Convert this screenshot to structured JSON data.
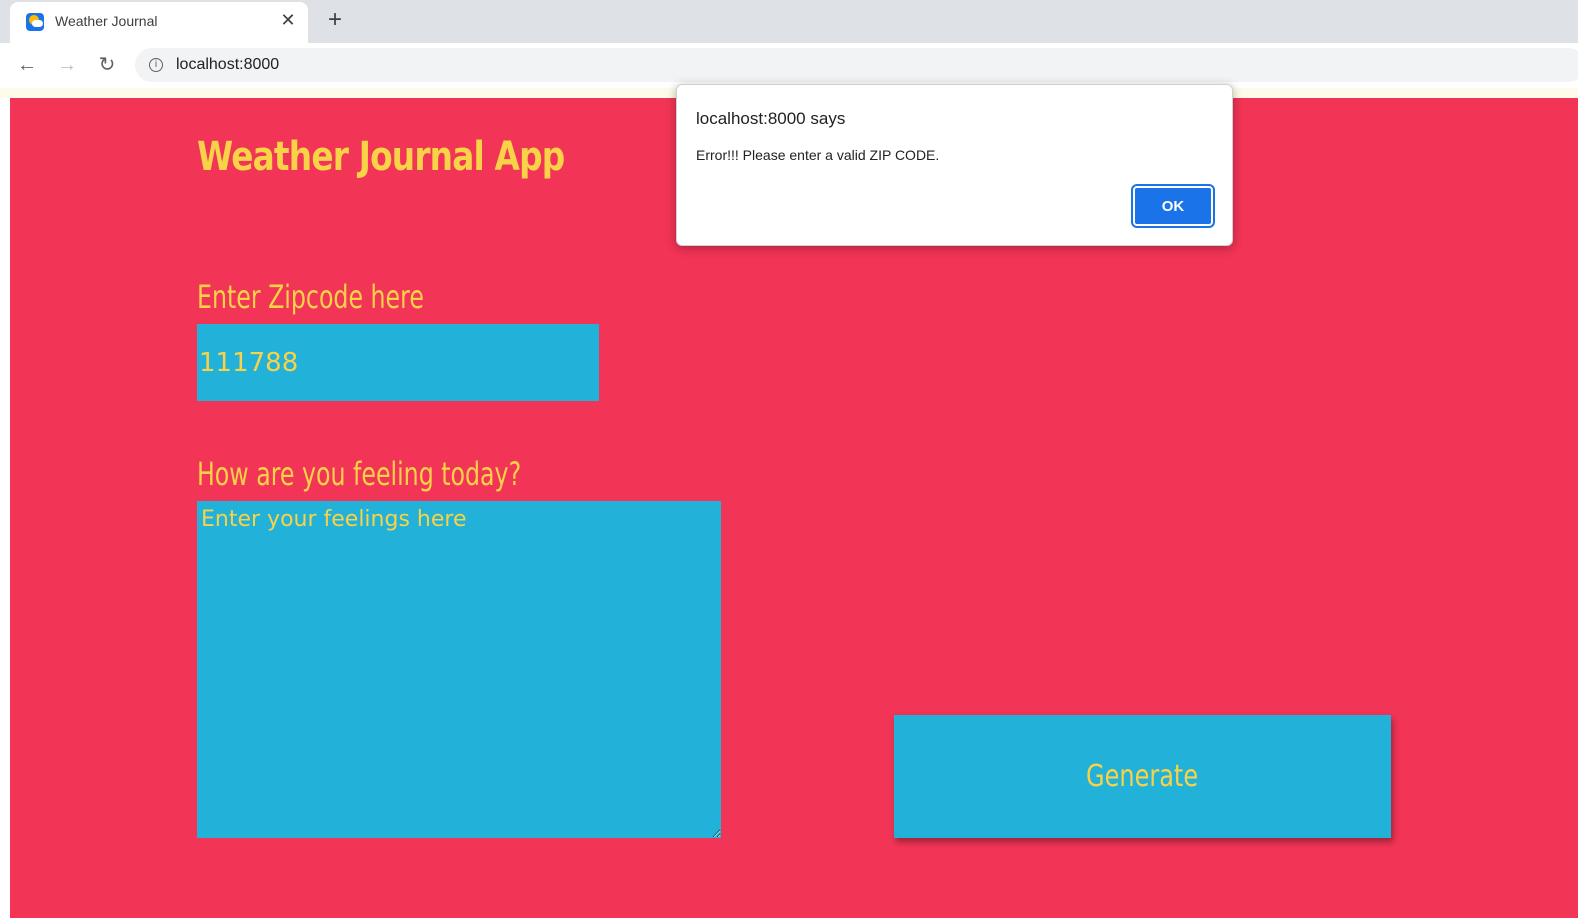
{
  "browser": {
    "tab": {
      "title": "Weather Journal",
      "favicon_icon": "weather-cloud-sun-icon",
      "close_glyph": "✕"
    },
    "new_tab_glyph": "+",
    "nav": {
      "back_glyph": "←",
      "forward_glyph": "→",
      "reload_glyph": "↻"
    },
    "omnibox": {
      "info_glyph": "i",
      "url": "localhost:8000"
    }
  },
  "page": {
    "title": "Weather Journal App",
    "zip": {
      "label": "Enter Zipcode here",
      "value": "111788"
    },
    "feelings": {
      "label": "How are you feeling today?",
      "placeholder": "Enter your feelings here"
    },
    "generate_label": "Generate"
  },
  "dialog": {
    "title": "localhost:8000 says",
    "message": "Error!!! Please enter a valid ZIP CODE.",
    "ok_label": "OK"
  },
  "colors": {
    "page_background": "#f23456",
    "accent_text": "#f8d247",
    "field_background": "#22b1d9",
    "dialog_button": "#1a73e8"
  }
}
